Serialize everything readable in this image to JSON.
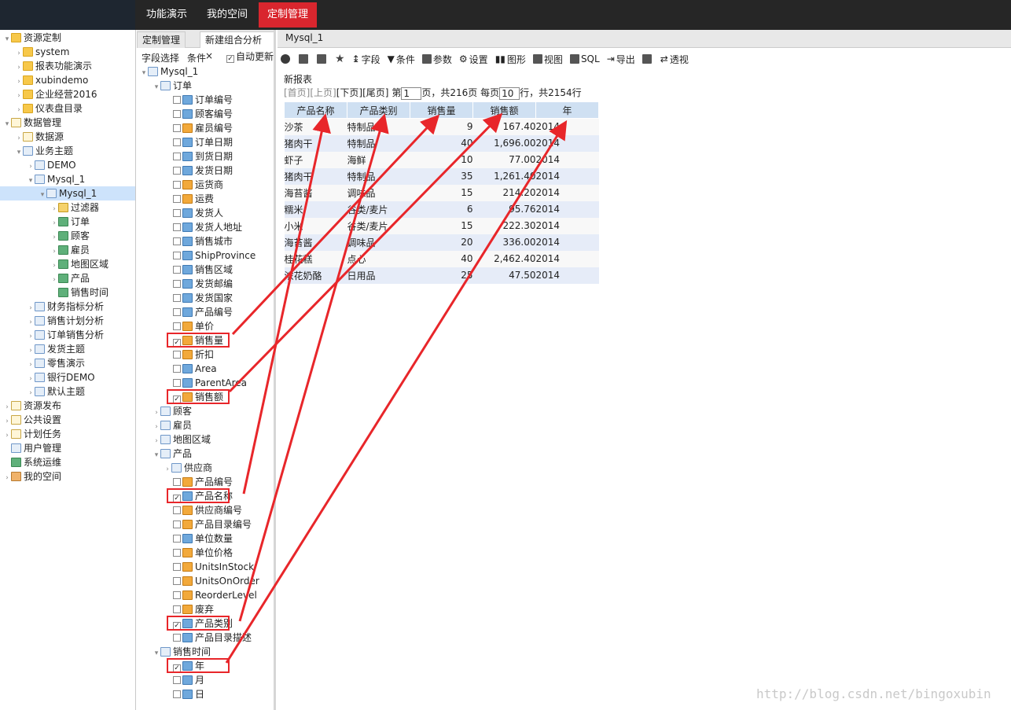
{
  "topnav": {
    "items": [
      "功能演示",
      "我的空间",
      "定制管理"
    ],
    "active_index": 2
  },
  "left_tree": [
    {
      "label": "资源定制",
      "arrow": "▾",
      "icon": "folder-icon"
    },
    {
      "label": "system",
      "arrow": "›",
      "icon": "folder-icon"
    },
    {
      "label": "报表功能演示",
      "arrow": "›",
      "icon": "folder-icon"
    },
    {
      "label": "xubindemo",
      "arrow": "›",
      "icon": "folder-icon"
    },
    {
      "label": "企业经营2016",
      "arrow": "›",
      "icon": "folder-icon"
    },
    {
      "label": "仪表盘目录",
      "arrow": "›",
      "icon": "folder-icon"
    },
    {
      "label": "数据管理",
      "arrow": "▾",
      "icon": "document-icon"
    },
    {
      "label": "数据源",
      "arrow": "›",
      "icon": "document-icon"
    },
    {
      "label": "业务主题",
      "arrow": "▾",
      "icon": "database-icon"
    },
    {
      "label": "DEMO",
      "arrow": "›",
      "icon": "database-icon"
    },
    {
      "label": "Mysql_1",
      "arrow": "▾",
      "icon": "database-icon"
    },
    {
      "label": "Mysql_1",
      "arrow": "▾",
      "icon": "database-icon"
    },
    {
      "label": "过滤器",
      "arrow": "›",
      "icon": "filter-icon"
    },
    {
      "label": "订单",
      "arrow": "›",
      "icon": "cube-icon"
    },
    {
      "label": "顾客",
      "arrow": "›",
      "icon": "cube-icon"
    },
    {
      "label": "雇员",
      "arrow": "›",
      "icon": "cube-icon"
    },
    {
      "label": "地图区域",
      "arrow": "›",
      "icon": "cube-icon"
    },
    {
      "label": "产品",
      "arrow": "›",
      "icon": "cube-icon"
    },
    {
      "label": "销售时间",
      "arrow": "",
      "icon": "cube-icon"
    },
    {
      "label": "财务指标分析",
      "arrow": "›",
      "icon": "database-icon"
    },
    {
      "label": "销售计划分析",
      "arrow": "›",
      "icon": "database-icon"
    },
    {
      "label": "订单销售分析",
      "arrow": "›",
      "icon": "database-icon"
    },
    {
      "label": "发货主题",
      "arrow": "›",
      "icon": "database-icon"
    },
    {
      "label": "零售演示",
      "arrow": "›",
      "icon": "database-icon"
    },
    {
      "label": "银行DEMO",
      "arrow": "›",
      "icon": "database-icon"
    },
    {
      "label": "默认主题",
      "arrow": "›",
      "icon": "database-icon"
    },
    {
      "label": "资源发布",
      "arrow": "›",
      "icon": "document-icon"
    },
    {
      "label": "公共设置",
      "arrow": "›",
      "icon": "document-icon"
    },
    {
      "label": "计划任务",
      "arrow": "›",
      "icon": "document-icon"
    },
    {
      "label": "用户管理",
      "arrow": "",
      "icon": "users-icon"
    },
    {
      "label": "系统运维",
      "arrow": "",
      "icon": "gear-icon"
    },
    {
      "label": "我的空间",
      "arrow": "›",
      "icon": "user-icon"
    }
  ],
  "mid_tabs": {
    "tab1": "定制管理",
    "tab2": "新建组合分析",
    "close": "×"
  },
  "mid_subtabs": {
    "field_select": "字段选择",
    "conditions": "条件",
    "auto_update": "自动更新"
  },
  "field_tree": [
    {
      "label": "Mysql_1",
      "kind": "root",
      "checked": false
    },
    {
      "label": "订单",
      "kind": "group",
      "checked": false
    },
    {
      "label": "订单编号",
      "kind": "dim",
      "checked": false
    },
    {
      "label": "顾客编号",
      "kind": "dim",
      "checked": false
    },
    {
      "label": "雇员编号",
      "kind": "meas",
      "checked": false
    },
    {
      "label": "订单日期",
      "kind": "dim",
      "checked": false
    },
    {
      "label": "到货日期",
      "kind": "dim",
      "checked": false
    },
    {
      "label": "发货日期",
      "kind": "dim",
      "checked": false
    },
    {
      "label": "运货商",
      "kind": "meas",
      "checked": false
    },
    {
      "label": "运费",
      "kind": "meas",
      "checked": false
    },
    {
      "label": "发货人",
      "kind": "dim",
      "checked": false
    },
    {
      "label": "发货人地址",
      "kind": "dim",
      "checked": false
    },
    {
      "label": "销售城市",
      "kind": "dim",
      "checked": false
    },
    {
      "label": "ShipProvince",
      "kind": "dim",
      "checked": false
    },
    {
      "label": "销售区域",
      "kind": "dim",
      "checked": false
    },
    {
      "label": "发货邮编",
      "kind": "dim",
      "checked": false
    },
    {
      "label": "发货国家",
      "kind": "dim",
      "checked": false
    },
    {
      "label": "产品编号",
      "kind": "dim",
      "checked": false
    },
    {
      "label": "单价",
      "kind": "meas",
      "checked": false
    },
    {
      "label": "销售量",
      "kind": "meas",
      "checked": true
    },
    {
      "label": "折扣",
      "kind": "meas",
      "checked": false
    },
    {
      "label": "Area",
      "kind": "dim",
      "checked": false
    },
    {
      "label": "ParentArea",
      "kind": "dim",
      "checked": false
    },
    {
      "label": "销售额",
      "kind": "meas",
      "checked": true
    },
    {
      "label": "顾客",
      "kind": "group2",
      "checked": false
    },
    {
      "label": "雇员",
      "kind": "group2",
      "checked": false
    },
    {
      "label": "地图区域",
      "kind": "group2",
      "checked": false
    },
    {
      "label": "产品",
      "kind": "group",
      "checked": false
    },
    {
      "label": "供应商",
      "kind": "subgroup",
      "checked": false
    },
    {
      "label": "产品编号",
      "kind": "meas",
      "checked": false
    },
    {
      "label": "产品名称",
      "kind": "dim",
      "checked": true
    },
    {
      "label": "供应商编号",
      "kind": "meas",
      "checked": false
    },
    {
      "label": "产品目录编号",
      "kind": "meas",
      "checked": false
    },
    {
      "label": "单位数量",
      "kind": "dim",
      "checked": false
    },
    {
      "label": "单位价格",
      "kind": "meas",
      "checked": false
    },
    {
      "label": "UnitsInStock",
      "kind": "meas",
      "checked": false
    },
    {
      "label": "UnitsOnOrder",
      "kind": "meas",
      "checked": false
    },
    {
      "label": "ReorderLevel",
      "kind": "meas",
      "checked": false
    },
    {
      "label": "废弃",
      "kind": "meas",
      "checked": false
    },
    {
      "label": "产品类别",
      "kind": "dim",
      "checked": true
    },
    {
      "label": "产品目录描述",
      "kind": "dim",
      "checked": false
    },
    {
      "label": "销售时间",
      "kind": "group",
      "checked": false
    },
    {
      "label": "年",
      "kind": "dim",
      "checked": true
    },
    {
      "label": "月",
      "kind": "dim",
      "checked": false
    },
    {
      "label": "日",
      "kind": "dim",
      "checked": false
    }
  ],
  "report_tab": "Mysql_1",
  "toolbar": {
    "field": "字段",
    "condition": "条件",
    "params": "参数",
    "settings": "设置",
    "chart": "图形",
    "view": "视图",
    "sql": "SQL",
    "export": "导出",
    "pivot": "透视"
  },
  "report": {
    "title": "新报表",
    "pager": {
      "first": "[首页]",
      "prev": "[上页]",
      "next": "[下页]",
      "last": "[尾页]",
      "page_prefix": "第",
      "page_value": "1",
      "page_suffix": "页，共216页 每页",
      "per_page_value": "10",
      "total_text": "行，共2154行"
    },
    "columns": [
      "产品名称",
      "产品类别",
      "销售量",
      "销售额",
      "年"
    ],
    "rows": [
      [
        "沙茶",
        "特制品",
        "9",
        "167.40",
        "2014"
      ],
      [
        "猪肉干",
        "特制品",
        "40",
        "1,696.00",
        "2014"
      ],
      [
        "虾子",
        "海鲜",
        "10",
        "77.00",
        "2014"
      ],
      [
        "猪肉干",
        "特制品",
        "35",
        "1,261.40",
        "2014"
      ],
      [
        "海苔酱",
        "调味品",
        "15",
        "214.20",
        "2014"
      ],
      [
        "糯米",
        "谷类/麦片",
        "6",
        "95.76",
        "2014"
      ],
      [
        "小米",
        "谷类/麦片",
        "15",
        "222.30",
        "2014"
      ],
      [
        "海苔酱",
        "调味品",
        "20",
        "336.00",
        "2014"
      ],
      [
        "桂花糕",
        "点心",
        "40",
        "2,462.40",
        "2014"
      ],
      [
        "浓花奶酪",
        "日用品",
        "25",
        "47.50",
        "2014"
      ]
    ]
  },
  "watermark": "http://blog.csdn.net/bingoxubin",
  "colors": {
    "active_tab": "#d9262e",
    "annotation": "#e8262a",
    "table_header": "#cfe0f2"
  }
}
